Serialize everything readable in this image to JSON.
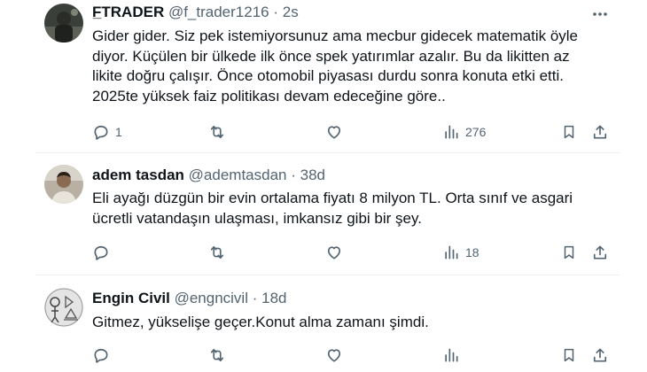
{
  "tweets": [
    {
      "name": "F̲TRADER",
      "handle": "@f_trader1216",
      "dot": "·",
      "time": "2s",
      "lines": [
        "Gider gider. Siz pek istemiyorsunuz ama mecbur gidecek matematik öyle",
        "diyor. Küçülen bir ülkede ilk önce spek yatırımlar azalır. Bu da likitten az",
        "likite doğru çalışır. Önce otomobil piyasası durdu sonra konuta etki etti.",
        "2025te yüksek faiz politikası devam edeceğine göre.."
      ],
      "reply_count": "1",
      "retweet_count": "",
      "like_count": "",
      "views_count": "276"
    },
    {
      "name": "adem tasdan",
      "handle": "@ademtasdan",
      "dot": "·",
      "time": "38d",
      "lines": [
        "Eli ayağı düzgün bir evin ortalama fiyatı 8 milyon TL. Orta sınıf ve asgari",
        "ücretli vatandaşın ulaşması, imkansız gibi bir şey."
      ],
      "reply_count": "",
      "retweet_count": "",
      "like_count": "",
      "views_count": "18"
    },
    {
      "name": "Engin Civil",
      "handle": "@engncivil",
      "dot": "·",
      "time": "18d",
      "lines": [
        "Gitmez, yükselişe geçer.Konut alma zamanı şimdi."
      ],
      "reply_count": "",
      "retweet_count": "",
      "like_count": "",
      "views_count": ""
    }
  ],
  "icons": {
    "reply": "reply-icon",
    "retweet": "retweet-icon",
    "like": "heart-icon",
    "views": "views-icon",
    "bookmark": "bookmark-icon",
    "share": "share-icon",
    "more": "more-icon"
  },
  "colors": {
    "text": "#0f1419",
    "secondary": "#536471",
    "divider": "#eff3f4"
  }
}
